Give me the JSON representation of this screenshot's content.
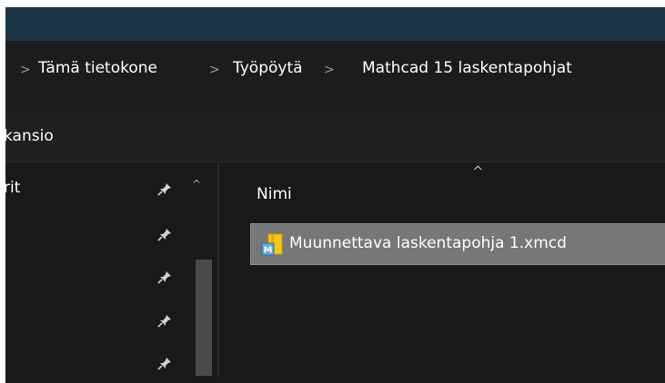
{
  "breadcrumb": {
    "items": [
      "Tämä tietokone",
      "Työpöytä",
      "Mathcad 15 laskentapohjat"
    ],
    "separator": ">"
  },
  "toolbar": {
    "new_folder_label": "kansio"
  },
  "nav": {
    "quick_access_label": "rit",
    "scroll_up_glyph": "^"
  },
  "file_list": {
    "column_name": "Nimi",
    "sort_indicator": "^",
    "files": [
      {
        "name": "Muunnettava laskentapohja 1.xmcd",
        "icon": "mathcad-file-icon"
      }
    ]
  },
  "colors": {
    "title_bar": "#1b3547",
    "background": "#191919",
    "selection": "#777777"
  }
}
